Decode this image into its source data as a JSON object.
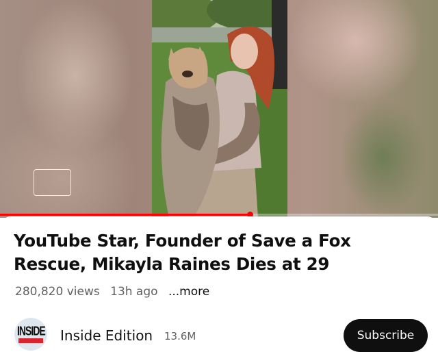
{
  "player": {
    "progress_fraction": 0.57,
    "captions_icon": "captions-icon"
  },
  "video": {
    "title": "YouTube Star, Founder of Save a Fox Rescue, Mikayla Raines Dies at 29",
    "views": "280,820 views",
    "age": "13h ago",
    "more_label": "...more"
  },
  "channel": {
    "name": "Inside Edition",
    "subscribers": "13.6M",
    "avatar_logo": "INSIDE",
    "subscribe_label": "Subscribe"
  },
  "colors": {
    "progress": "#ff0000",
    "subscribe_bg": "#0f0f0f",
    "meta_text": "#606060"
  }
}
